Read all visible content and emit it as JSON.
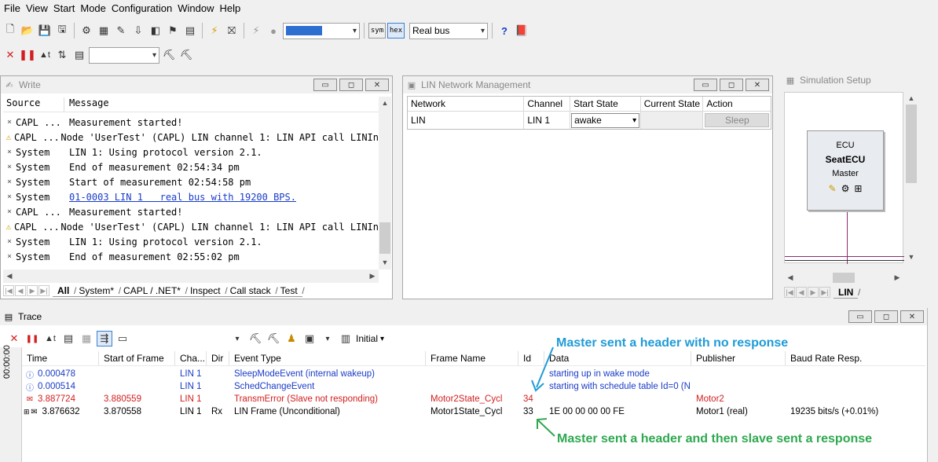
{
  "menu": [
    "File",
    "View",
    "Start",
    "Mode",
    "Configuration",
    "Window",
    "Help"
  ],
  "toolbar": {
    "sym_label": "sym",
    "hex_label": "hex",
    "bus_select": "Real bus"
  },
  "write": {
    "title": "Write",
    "columns": [
      "Source",
      "Message"
    ],
    "rows": [
      {
        "icon": "dot",
        "source": "CAPL ...",
        "message": "Measurement started!"
      },
      {
        "icon": "warning",
        "source": "CAPL ...",
        "message": "Node 'UserTest' (CAPL) LIN channel 1: LIN API call LINIn"
      },
      {
        "icon": "dot",
        "source": "System",
        "message": "LIN 1: Using protocol version 2.1."
      },
      {
        "icon": "dot",
        "source": "System",
        "message": "End of measurement 02:54:34 pm"
      },
      {
        "icon": "dot",
        "source": "System",
        "message": "Start of measurement 02:54:58 pm"
      },
      {
        "icon": "dot",
        "source": "System",
        "message": "01-0003 LIN 1   real bus with 19200 BPS.",
        "link": true
      },
      {
        "icon": "dot",
        "source": "CAPL ...",
        "message": "Measurement started!"
      },
      {
        "icon": "warning",
        "source": "CAPL ...",
        "message": "Node 'UserTest' (CAPL) LIN channel 1: LIN API call LINIn"
      },
      {
        "icon": "dot",
        "source": "System",
        "message": "LIN 1: Using protocol version 2.1."
      },
      {
        "icon": "dot",
        "source": "System",
        "message": "End of measurement 02:55:02 pm"
      }
    ],
    "tabs": [
      "All",
      "System*",
      "CAPL / .NET*",
      "Inspect",
      "Call stack",
      "Test"
    ]
  },
  "linnm": {
    "title": "LIN Network Management",
    "columns": [
      "Network",
      "Channel",
      "Start State",
      "Current State",
      "Action"
    ],
    "row": {
      "network": "LIN",
      "channel": "LIN 1",
      "start_state": "awake",
      "current_state": "",
      "action": "Sleep"
    }
  },
  "simsetup": {
    "title": "Simulation Setup",
    "ecu_type": "ECU",
    "ecu_name": "SeatECU",
    "ecu_role": "Master",
    "tab": "LIN"
  },
  "trace": {
    "title": "Trace",
    "filter_label": "Initial",
    "vertical_time": "00:00:00",
    "columns": [
      "Time",
      "Start of Frame",
      "Cha...",
      "Dir",
      "Event Type",
      "Frame Name",
      "Id",
      "Data",
      "Publisher",
      "Baud Rate Resp."
    ],
    "rows": [
      {
        "style": "blue",
        "icon": "info",
        "time": "0.000478",
        "sof": "",
        "ch": "LIN 1",
        "dir": "",
        "event": "SleepModeEvent (internal wakeup)",
        "frame": "",
        "id": "",
        "data": "starting up in wake mode",
        "pub": "",
        "baud": ""
      },
      {
        "style": "blue",
        "icon": "info",
        "time": "0.000514",
        "sof": "",
        "ch": "LIN 1",
        "dir": "",
        "event": "SchedChangeEvent",
        "frame": "",
        "id": "",
        "data": "starting with schedule table Id=0 (N...",
        "pub": "",
        "baud": ""
      },
      {
        "style": "red",
        "icon": "error",
        "time": "3.887724",
        "sof": "3.880559",
        "ch": "LIN 1",
        "dir": "",
        "event": "TransmError (Slave not responding)",
        "frame": "Motor2State_Cycl",
        "id": "34",
        "data": "",
        "pub": "Motor2",
        "baud": ""
      },
      {
        "style": "black",
        "icon": "frame",
        "time": "3.876632",
        "sof": "3.870558",
        "ch": "LIN 1",
        "dir": "Rx",
        "event": "LIN Frame (Unconditional)",
        "frame": "Motor1State_Cycl",
        "id": "33",
        "data": "1E 00 00 00 00 FE",
        "pub": "Motor1 (real)",
        "baud": "19235 bits/s (+0.01%)"
      }
    ]
  },
  "annotations": {
    "top": "Master sent a header with no response",
    "bottom": "Master sent a header and then slave sent a response"
  },
  "colors": {
    "annot_top": "#1f9bd7",
    "annot_bottom": "#2fa84f",
    "error": "#d21e1e",
    "info": "#1a3cc8"
  }
}
